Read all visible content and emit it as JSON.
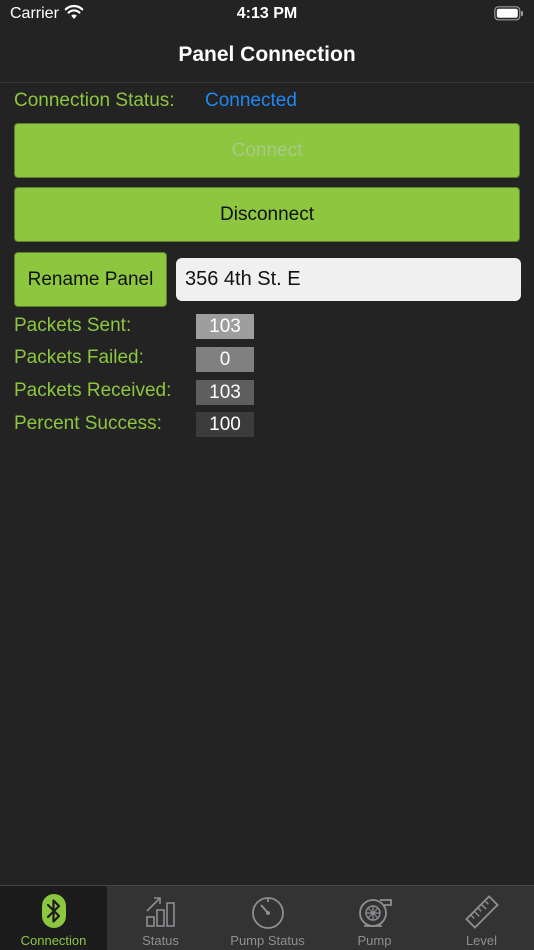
{
  "status_bar": {
    "carrier": "Carrier",
    "time": "4:13 PM"
  },
  "nav": {
    "title": "Panel Connection"
  },
  "connection": {
    "label": "Connection Status:",
    "value": "Connected"
  },
  "buttons": {
    "connect": "Connect",
    "disconnect": "Disconnect",
    "rename": "Rename Panel"
  },
  "panel_name": {
    "value": "356 4th St. E"
  },
  "stats": [
    {
      "label": "Packets Sent:",
      "value": "103"
    },
    {
      "label": "Packets Failed:",
      "value": "0"
    },
    {
      "label": "Packets Received:",
      "value": "103"
    },
    {
      "label": "Percent Success:",
      "value": "100"
    }
  ],
  "tabs": [
    {
      "label": "Connection",
      "icon": "bluetooth-icon",
      "active": true
    },
    {
      "label": "Status",
      "icon": "bar-chart-icon",
      "active": false
    },
    {
      "label": "Pump Status",
      "icon": "gauge-icon",
      "active": false
    },
    {
      "label": "Pump",
      "icon": "pump-icon",
      "active": false
    },
    {
      "label": "Level",
      "icon": "ruler-icon",
      "active": false
    }
  ],
  "colors": {
    "accent": "#8dc63f",
    "status_connected": "#1e88f5",
    "background": "#232323"
  }
}
